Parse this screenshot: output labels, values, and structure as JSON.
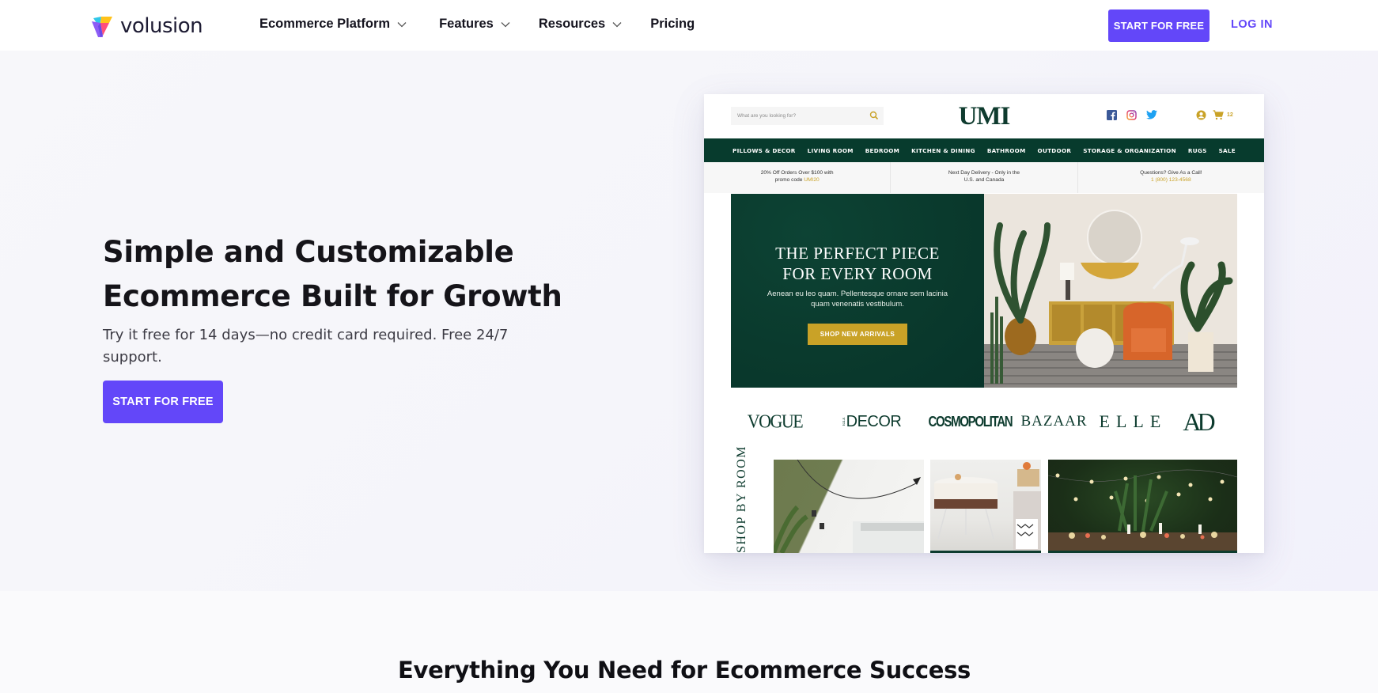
{
  "header": {
    "logo_text": "volusion",
    "nav": [
      {
        "label": "Ecommerce Platform",
        "has_dropdown": true
      },
      {
        "label": "Features",
        "has_dropdown": true
      },
      {
        "label": "Resources",
        "has_dropdown": true
      },
      {
        "label": "Pricing",
        "has_dropdown": false
      }
    ],
    "start_button": "START FOR FREE",
    "login_link": "LOG IN"
  },
  "hero": {
    "title_line1": "Simple and Customizable",
    "title_line2": "Ecommerce Built for Growth",
    "subtitle": "Try it free for 14 days—no credit card required. Free 24/7 support.",
    "cta": "START FOR FREE"
  },
  "mockup": {
    "search_placeholder": "What are you looking for?",
    "store_logo": "UMI",
    "social_icons": [
      "facebook-icon",
      "instagram-icon",
      "twitter-icon"
    ],
    "cart_count": "12",
    "nav": [
      "PILLOWS & DECOR",
      "LIVING ROOM",
      "BEDROOM",
      "KITCHEN & DINING",
      "BATHROOM",
      "OUTDOOR",
      "STORAGE & ORGANIZATION",
      "RUGS",
      "SALE"
    ],
    "promos": [
      {
        "line1": "20% Off Orders Over $100 with",
        "line2_prefix": "promo code ",
        "highlight": "UMI20"
      },
      {
        "line1": "Next Day Delivery - Only in the",
        "line2_prefix": "U.S. and Canada",
        "highlight": ""
      },
      {
        "line1": "Questions? Give As a Call!",
        "line2_prefix": "",
        "highlight": "1 (800) 123-4568"
      }
    ],
    "banner": {
      "title_line1": "THE PERFECT PIECE",
      "title_line2": "FOR EVERY ROOM",
      "text": "Aenean eu leo quam. Pellentesque ornare sem lacinia quam venenatis vestibulum.",
      "button": "SHOP NEW ARRIVALS"
    },
    "press": [
      "VOGUE",
      "DECOR",
      "COSMOPOLITAN",
      "BAZAAR",
      "ELLE",
      "AD"
    ],
    "press_decor_prefix": "ELLE",
    "shop_by_room": "SHOP BY ROOM"
  },
  "section": {
    "title": "Everything You Need for Ecommerce Success"
  },
  "colors": {
    "brand_purple": "#6347f9",
    "umi_green": "#073b2d",
    "umi_gold": "#c9a227"
  }
}
